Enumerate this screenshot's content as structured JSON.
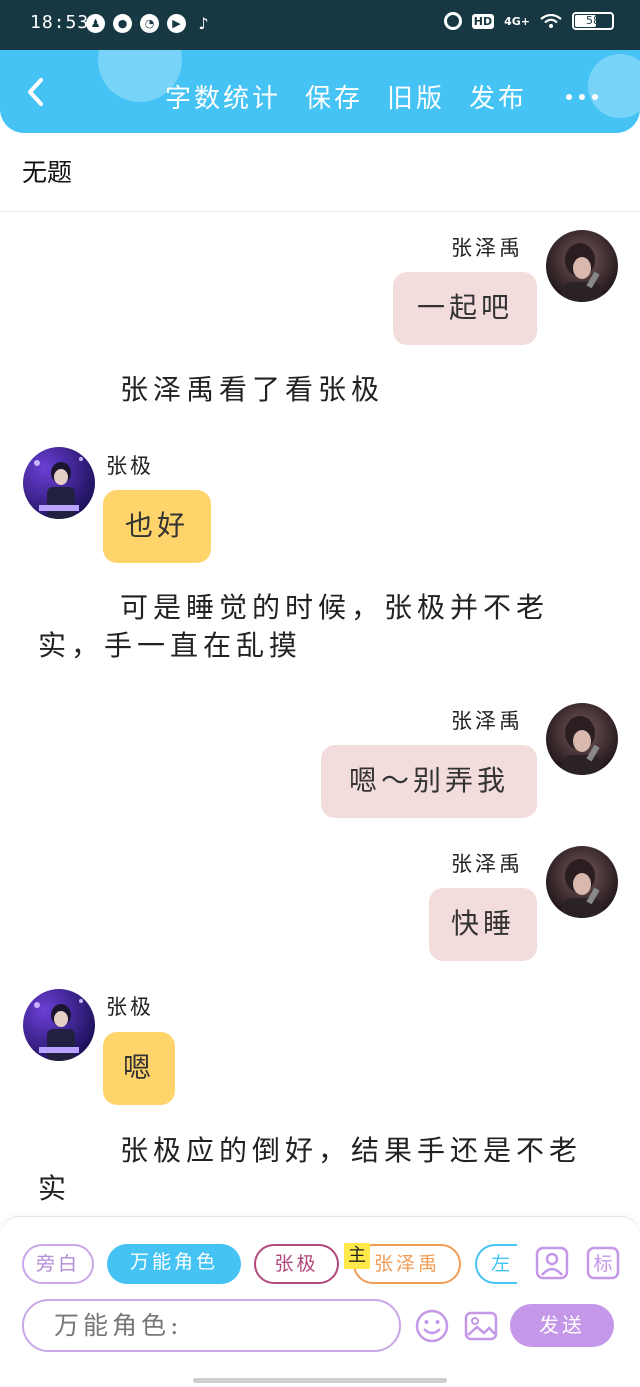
{
  "status_bar": {
    "time": "18:53",
    "network": "4G+",
    "hd_badge": "HD",
    "battery": "58",
    "app_icons": [
      "qq-icon",
      "wechat-icon",
      "browser-icon",
      "video-icon",
      "tiktok-icon"
    ]
  },
  "header": {
    "actions": [
      "字数统计",
      "保存",
      "旧版",
      "发布"
    ],
    "accent_color": "#45c3f5"
  },
  "document": {
    "title": "无题"
  },
  "messages": [
    {
      "kind": "chat",
      "side": "right",
      "speaker": "张泽禹",
      "text": "一起吧"
    },
    {
      "kind": "narration",
      "text": "张泽禹看了看张极"
    },
    {
      "kind": "chat",
      "side": "left",
      "speaker": "张极",
      "text": "也好"
    },
    {
      "kind": "narration",
      "text": "可是睡觉的时候，张极并不老实，手一直在乱摸"
    },
    {
      "kind": "chat",
      "side": "right",
      "speaker": "张泽禹",
      "text": "嗯～别弄我"
    },
    {
      "kind": "chat",
      "side": "right",
      "speaker": "张泽禹",
      "text": "快睡"
    },
    {
      "kind": "chat",
      "side": "left",
      "speaker": "张极",
      "text": "嗯"
    },
    {
      "kind": "narration",
      "text": "张极应的倒好，结果手还是不老实"
    }
  ],
  "toolbar": {
    "roles": {
      "narrator": "旁白",
      "universal": "万能角色",
      "zhangji": "张极",
      "zhangzeyu": "张泽禹",
      "left": "左"
    },
    "main_tag": "主",
    "tag_icon_label": "标",
    "input_value": "万能角色:",
    "send_label": "发送"
  }
}
